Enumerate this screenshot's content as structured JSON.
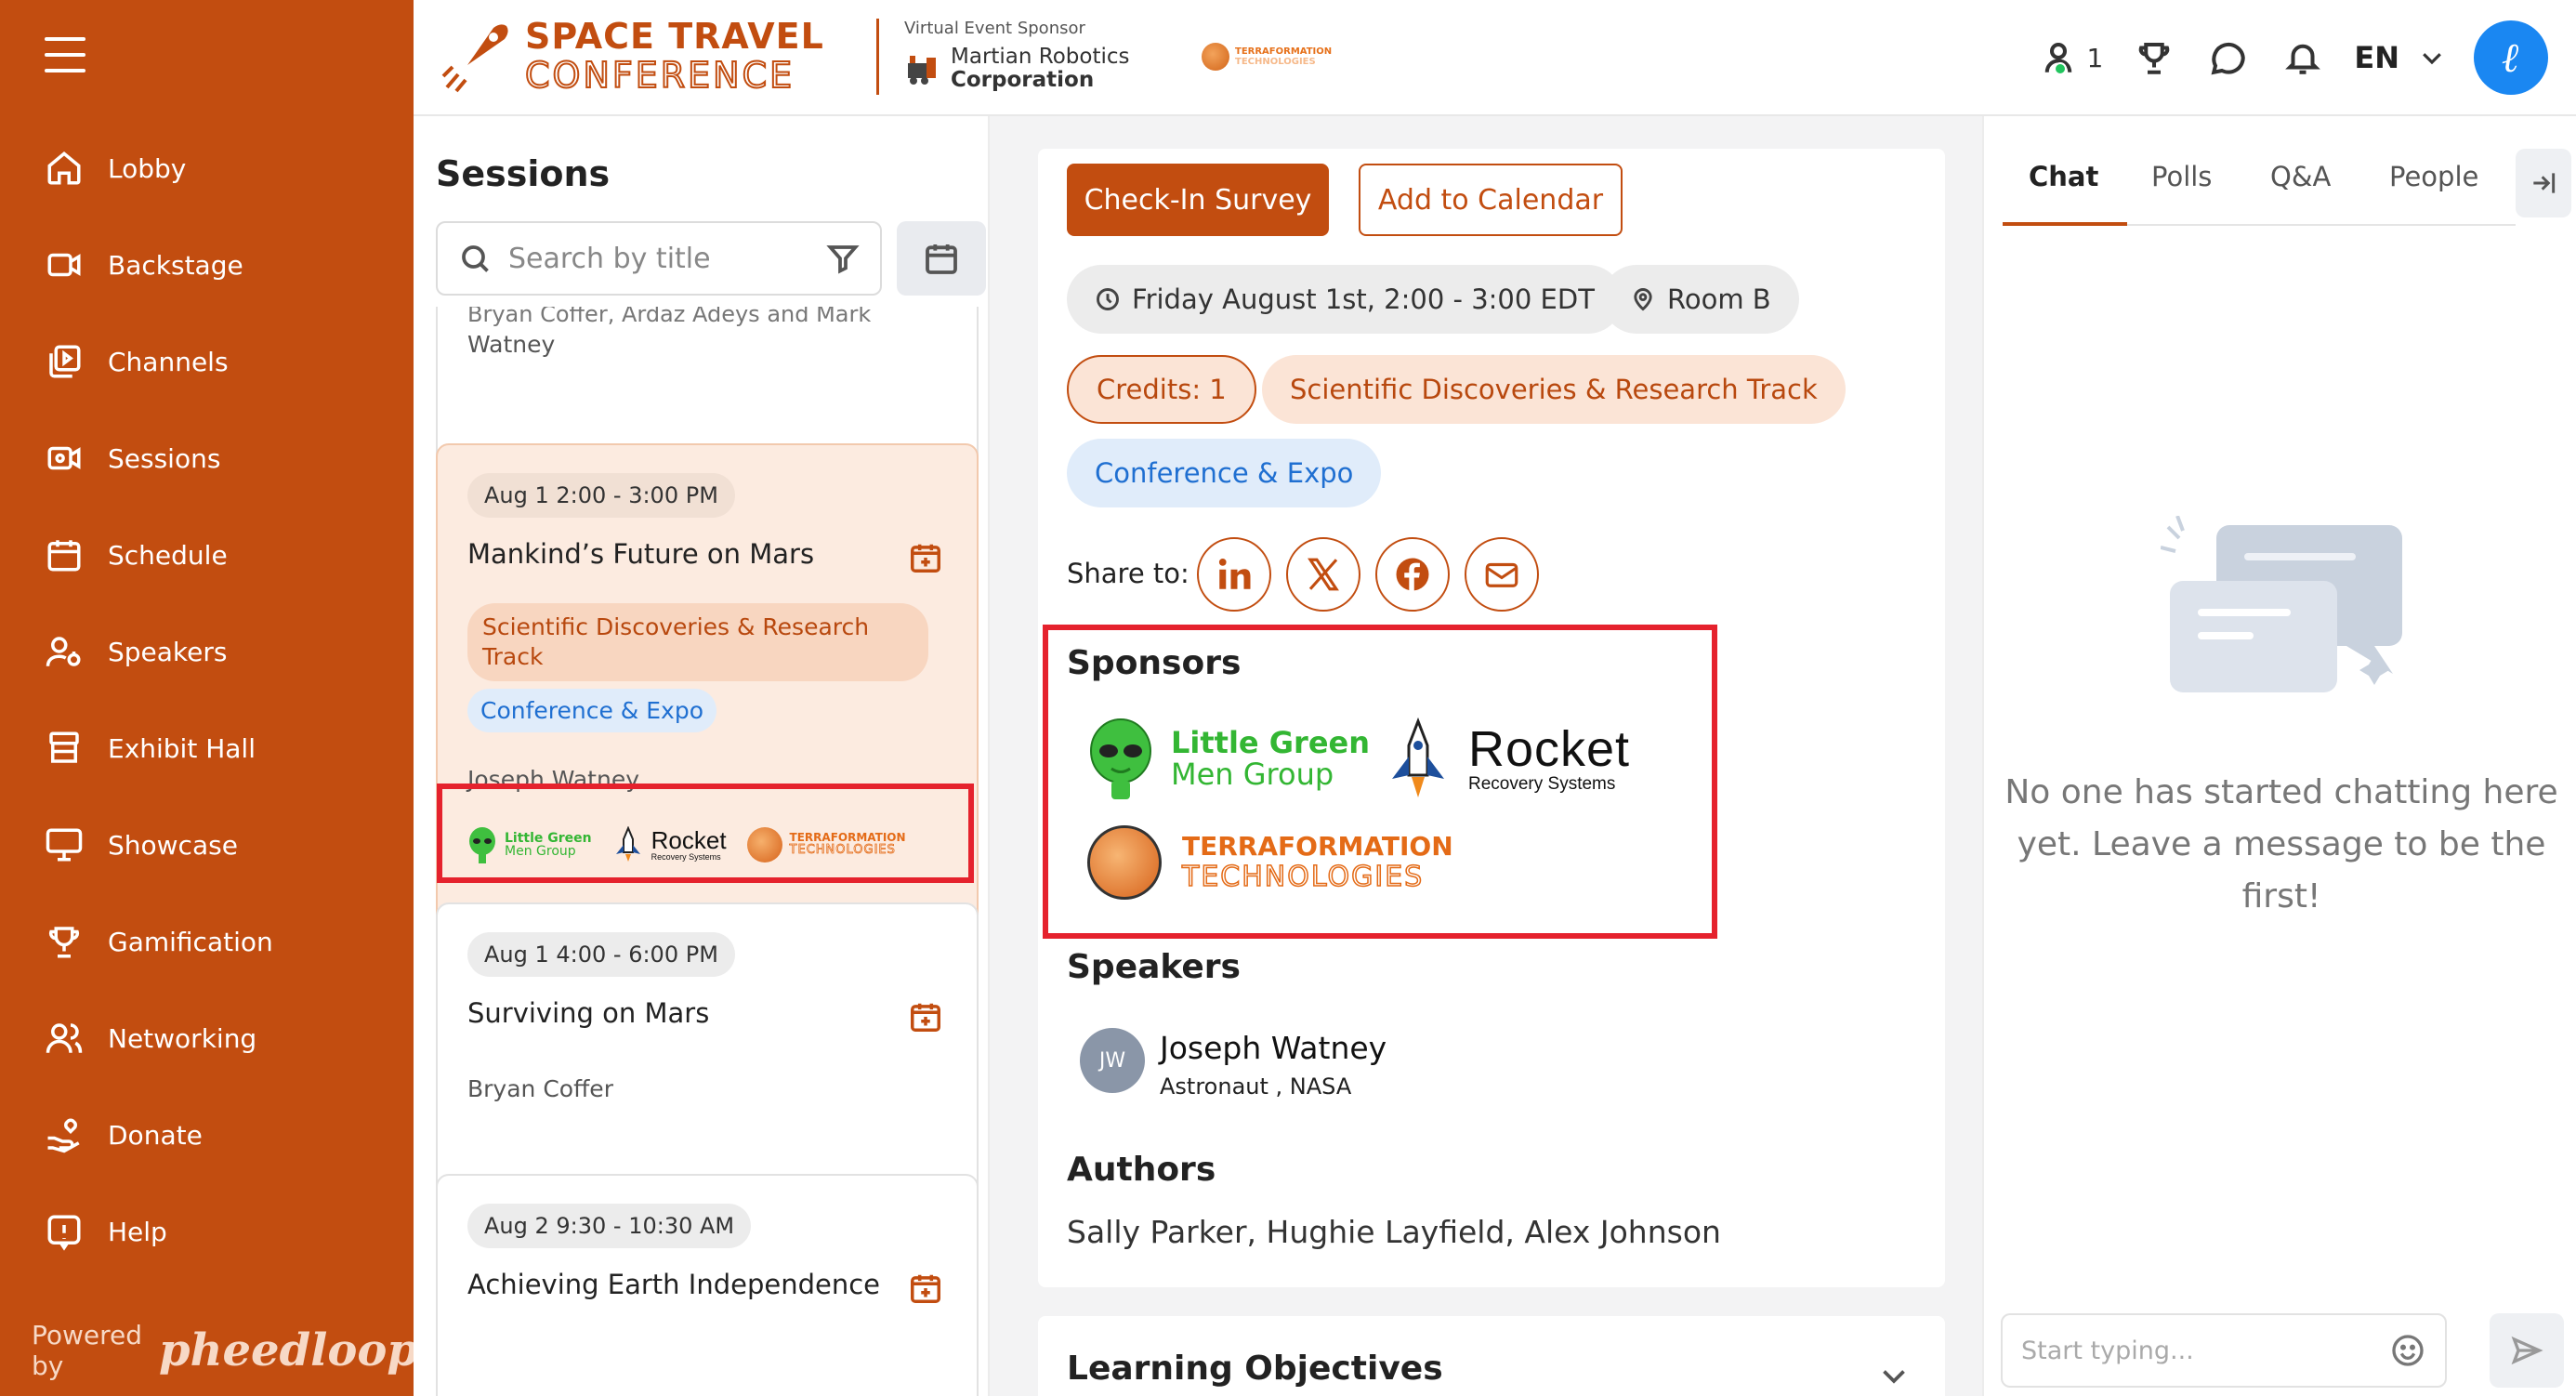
{
  "colors": {
    "brand": "#c24d10",
    "highlight": "#e5222d",
    "link_blue": "#1f6fd1",
    "online": "#22c55e"
  },
  "sidebar": {
    "items": [
      {
        "label": "Lobby",
        "icon": "home-icon"
      },
      {
        "label": "Backstage",
        "icon": "video-icon"
      },
      {
        "label": "Channels",
        "icon": "play-stack-icon"
      },
      {
        "label": "Sessions",
        "icon": "camera-icon"
      },
      {
        "label": "Schedule",
        "icon": "calendar-icon"
      },
      {
        "label": "Speakers",
        "icon": "speaker-user-icon"
      },
      {
        "label": "Exhibit Hall",
        "icon": "booth-icon"
      },
      {
        "label": "Showcase",
        "icon": "presentation-icon"
      },
      {
        "label": "Gamification",
        "icon": "trophy-icon"
      },
      {
        "label": "Networking",
        "icon": "users-icon"
      },
      {
        "label": "Donate",
        "icon": "hand-heart-icon"
      },
      {
        "label": "Help",
        "icon": "info-icon"
      }
    ],
    "powered_by": "Powered by",
    "powered_logo": "pheedloop"
  },
  "header": {
    "brand_line1": "SPACE TRAVEL",
    "brand_line2": "CONFERENCE",
    "sponsor_caption": "Virtual Event Sponsor",
    "sponsor_name_line1": "Martian Robotics",
    "sponsor_name_line2": "Corporation",
    "mini_logo_line1": "TERRAFORMATION",
    "mini_logo_line2": "TECHNOLOGIES",
    "online_count": "1",
    "language": "EN"
  },
  "sessions": {
    "title": "Sessions",
    "search_placeholder": "Search by title",
    "cards": [
      {
        "speakers_partial_top": "Bryan Coffer, Ardaz Adeys and Mark",
        "speakers_partial_bottom": "Watney"
      },
      {
        "time": "Aug 1 2:00 - 3:00 PM",
        "title": "Mankind’s Future on Mars",
        "track": "Scientific Discoveries & Research Track",
        "conference": "Conference & Expo",
        "speakers": "Joseph Watney"
      },
      {
        "time": "Aug 1 4:00 - 6:00 PM",
        "title": "Surviving on Mars",
        "speakers": "Bryan Coffer"
      },
      {
        "time": "Aug 2 9:30 - 10:30 AM",
        "title": "Achieving Earth Independence"
      }
    ]
  },
  "sponsor_logos": {
    "green_line1": "Little Green",
    "green_line2": "Men Group",
    "rocket_line1": "Rocket",
    "rocket_line2": "Recovery Systems",
    "tf_line1": "TERRAFORMATION",
    "tf_line2": "TECHNOLOGIES"
  },
  "detail": {
    "checkin_label": "Check-In Survey",
    "calendar_label": "Add to Calendar",
    "datetime": "Friday August 1st, 2:00 - 3:00 EDT",
    "room": "Room B",
    "credits": "Credits: 1",
    "track": "Scientific Discoveries & Research Track",
    "conference": "Conference & Expo",
    "share_label": "Share to:",
    "sponsors_title": "Sponsors",
    "speakers_title": "Speakers",
    "speaker": {
      "initials": "JW",
      "name": "Joseph Watney",
      "role": "Astronaut ,  NASA"
    },
    "authors_title": "Authors",
    "authors": "Sally Parker, Hughie Layfield, Alex Johnson",
    "learning_title": "Learning Objectives"
  },
  "chat": {
    "tabs": [
      "Chat",
      "Polls",
      "Q&A",
      "People"
    ],
    "empty_message": "No one has started chatting here yet. Leave a message to be the first!",
    "input_placeholder": "Start typing..."
  }
}
